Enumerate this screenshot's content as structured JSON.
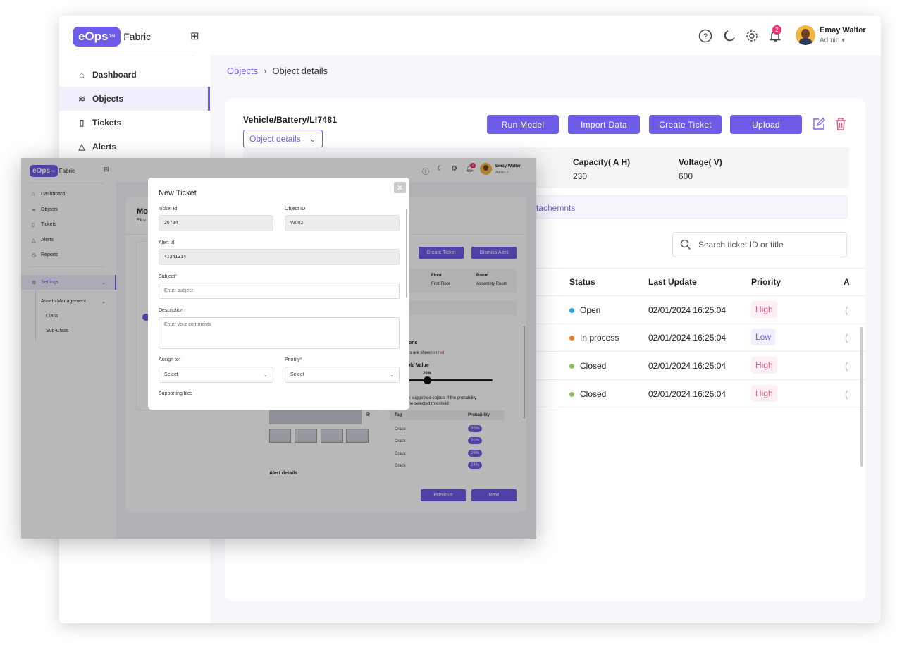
{
  "back": {
    "brand": {
      "logo": "eOps",
      "tm": "TM",
      "suffix": "Fabric"
    },
    "sidebar": [
      {
        "label": "Dashboard",
        "icon": "home-icon"
      },
      {
        "label": "Objects",
        "icon": "layers-icon",
        "active": true
      },
      {
        "label": "Tickets",
        "icon": "book-icon"
      },
      {
        "label": "Alerts",
        "icon": "alert-icon"
      }
    ],
    "header": {
      "notifications": "2",
      "user_name": "Emay Walter",
      "user_role": "Admin"
    },
    "breadcrumb": {
      "parent": "Objects",
      "current": "Object details"
    },
    "object": {
      "path": "Vehicle/Battery/LI7481",
      "view_select": "Object details"
    },
    "buttons": {
      "run_model": "Run Model",
      "import_data": "Import Data",
      "create_ticket": "Create Ticket",
      "upload": "Upload"
    },
    "props": [
      {
        "label": "Capacity( A H)",
        "value": "230"
      },
      {
        "label": "Voltage( V)",
        "value": "600"
      }
    ],
    "tab_partial": "tachemnts",
    "search_placeholder": "Search ticket ID or title",
    "table": {
      "headers": [
        "Status",
        "Last Update",
        "Priority",
        "A"
      ],
      "rows": [
        {
          "status": "Open",
          "status_color": "#2aa6e0",
          "updated": "02/01/2024 16:25:04",
          "priority": "High",
          "tail": "("
        },
        {
          "status": "In process",
          "status_color": "#f07a1a",
          "updated": "02/01/2024 16:25:04",
          "priority": "Low",
          "tail": "("
        },
        {
          "status": "Closed",
          "status_color": "#8cbf5a",
          "updated": "02/01/2024 16:25:04",
          "priority": "High",
          "tail": "("
        },
        {
          "status": "Closed",
          "status_color": "#8cbf5a",
          "updated": "02/01/2024 16:25:04",
          "priority": "High",
          "tail": "("
        }
      ]
    }
  },
  "front": {
    "brand": {
      "logo": "eOps",
      "tm": "TM",
      "suffix": "Fabric"
    },
    "sidebar": [
      {
        "label": "Dashboard"
      },
      {
        "label": "Objects"
      },
      {
        "label": "Tickets"
      },
      {
        "label": "Alerts"
      },
      {
        "label": "Reports"
      },
      {
        "label": "Settings"
      },
      {
        "label": "Assets Management"
      },
      {
        "label": "Class"
      },
      {
        "label": "Sub-Class"
      }
    ],
    "header": {
      "notifications": "2",
      "user_name": "Emay Walter",
      "user_role": "Admin"
    },
    "page_title_partial": "Mo",
    "page_sub_partial": "Fill u",
    "buttons": {
      "create_ticket": "Create Ticket",
      "dismiss_alert": "Dismiss Alert",
      "previous": "Previous",
      "next": "Next"
    },
    "location": {
      "floor_label": "Floor",
      "floor_value": "First Floor",
      "room_label": "Room",
      "room_value": "Assembly Room"
    },
    "predictions": {
      "title_partial": "ions",
      "note_partial": "ns are shown in ",
      "note_red": "red",
      "threshold_label_partial": "old Value",
      "threshold_value": "20%",
      "threshold_level": 0.2,
      "hint_line1": "w suggested objects if the probability",
      "hint_line2": "the selected threshold",
      "table_headers": [
        "Tag",
        "Probability"
      ],
      "rows": [
        {
          "tag": "Crack",
          "prob": "35%"
        },
        {
          "tag": "Crack",
          "prob": "31%"
        },
        {
          "tag": "Crack",
          "prob": "26%"
        },
        {
          "tag": "Crack",
          "prob": "24%"
        }
      ]
    },
    "alert_details": "Alert details",
    "modal": {
      "title": "New Ticket",
      "ticket_id_label": "Ticket Id",
      "ticket_id": "26784",
      "object_id_label": "Object ID",
      "object_id": "W002",
      "alert_id_label": "Alert Id",
      "alert_id": "41341314",
      "subject_label": "Subject",
      "subject_placeholder": "Enter subject",
      "description_label": "Description",
      "description_placeholder": "Enter your comments",
      "assign_label": "Assign to",
      "assign_value": "Select",
      "priority_label": "Priority",
      "priority_value": "Select",
      "files_label": "Supporting files"
    }
  }
}
